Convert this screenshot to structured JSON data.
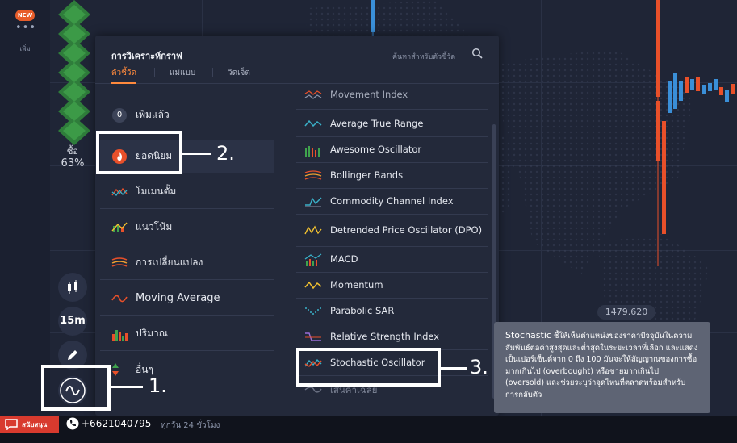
{
  "left_rail": {
    "new_badge": "NEW",
    "more_label": "เพิ่ม",
    "buy_label": "ซื้อ",
    "buy_percent": "63%"
  },
  "tools": {
    "timeframe": "15m"
  },
  "panel": {
    "title": "การวิเคราะห์กราฟ",
    "search_placeholder": "ค้นหาสำหรับตัวชี้วัด",
    "tabs": [
      "ตัวชี้วัด",
      "แม่แบบ",
      "วิดเจ็ต"
    ],
    "categories": [
      {
        "label": "เพิ่มแล้ว",
        "count": "0"
      },
      {
        "label": "ยอดนิยม"
      },
      {
        "label": "โมเมนตั้ม"
      },
      {
        "label": "แนวโน้ม"
      },
      {
        "label": "การเปลี่ยนแปลง"
      },
      {
        "label": "Moving Average"
      },
      {
        "label": "ปริมาณ"
      },
      {
        "label": "อื่นๆ"
      }
    ],
    "indicators": [
      "Movement Index",
      "Average True Range",
      "Awesome Oscillator",
      "Bollinger Bands",
      "Commodity Channel Index",
      "Detrended Price Oscillator (DPO)",
      "MACD",
      "Momentum",
      "Parabolic SAR",
      "Relative Strength Index",
      "Stochastic Oscillator",
      "เส้นค่าเฉลี่ย"
    ]
  },
  "annotations": {
    "n1": "1.",
    "n2": "2.",
    "n3": "3."
  },
  "tooltip": {
    "lead": "Stochastic",
    "body": " ชี้ให้เห็นตำแหน่งของราคาปัจจุบันในความสัมพันธ์ต่อค่าสูงสุดและต่ำสุดในระยะเวลาที่เลือก และแสดงเป็นเปอร์เซ็นต์จาก 0 ถึง 100 มันจะให้สัญญาณของการซื้อมากเกินไป (overbought) หรือขายมากเกินไป (oversold) และช่วยระบุว่าจุดไหนที่ตลาดพร้อมสำหรับการกลับตัว"
  },
  "chart": {
    "price_label": "1479.620"
  },
  "bottom_bar": {
    "support_label": "สนับสนุน",
    "phone": "+6621040795",
    "hours": "ทุกวัน 24 ชั่วโมง"
  },
  "colors": {
    "accent": "#ff8a3d",
    "candle_up": "#3a8fd8",
    "candle_down": "#e8502a",
    "buy_green": "#3fa34d"
  }
}
